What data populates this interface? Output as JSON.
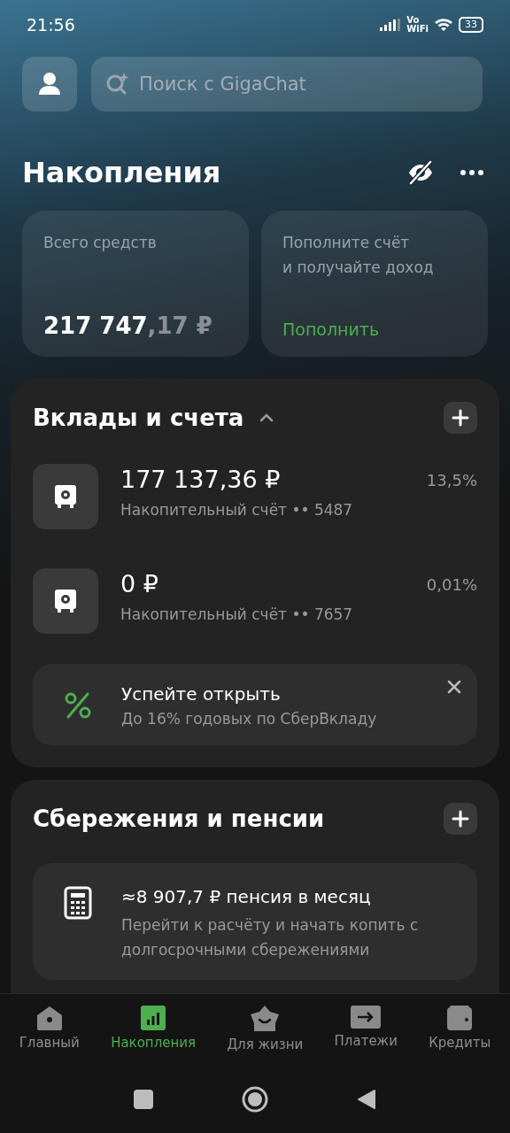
{
  "status_bar": {
    "time": "21:56",
    "vowifi_top": "Vo",
    "vowifi_bottom": "WiFi",
    "battery": "33"
  },
  "search": {
    "placeholder": "Поиск с GigaChat"
  },
  "page_title": "Накопления",
  "total_card": {
    "label": "Всего средств",
    "amount_main": "217 747",
    "amount_fraction": ",17 ₽"
  },
  "topup_card": {
    "text": "Пополните счёт\nи получайте доход",
    "action": "Пополнить"
  },
  "deposits": {
    "title": "Вклады и счета",
    "expanded": true,
    "accounts": [
      {
        "amount": "177 137,36 ₽",
        "name": "Накопительный счёт •• 5487",
        "rate": "13,5%"
      },
      {
        "amount": "0 ₽",
        "name": "Накопительный счёт •• 7657",
        "rate": "0,01%"
      }
    ],
    "promo": {
      "title": "Успейте открыть",
      "subtitle": "До 16% годовых по СберВкладу"
    }
  },
  "savings": {
    "title": "Сбережения и пенсии",
    "item": {
      "title": "≈8 907,7 ₽ пенсия в месяц",
      "description": "Перейти к расчёту и начать копить с долгосрочными сбережениями"
    }
  },
  "bottom_nav": [
    {
      "kind": "home",
      "label": "Главный",
      "selected": false
    },
    {
      "kind": "savings",
      "label": "Накопления",
      "selected": true
    },
    {
      "kind": "life",
      "label": "Для жизни",
      "selected": false
    },
    {
      "kind": "payments",
      "label": "Платежи",
      "selected": false
    },
    {
      "kind": "credits",
      "label": "Кредиты",
      "selected": false
    }
  ]
}
